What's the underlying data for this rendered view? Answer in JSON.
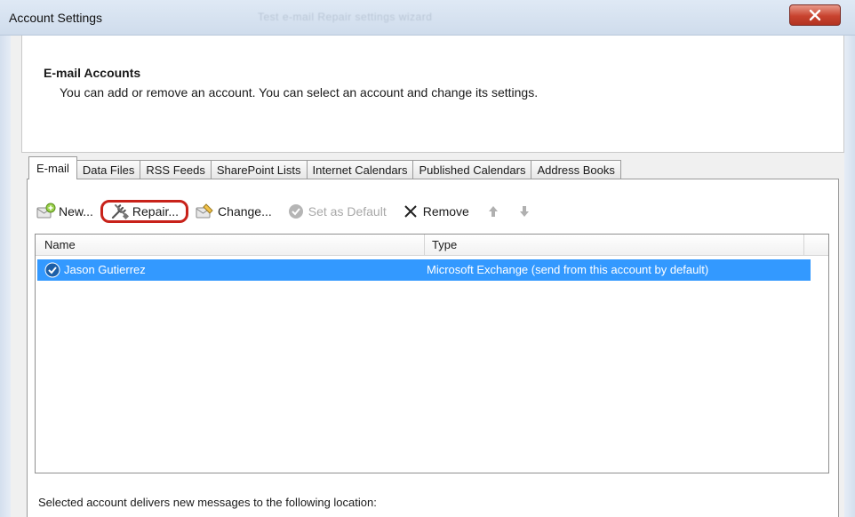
{
  "window": {
    "title": "Account Settings",
    "title_ghost": "Test e-mail   Repair settings wizard",
    "close_label": "close"
  },
  "header": {
    "title": "E-mail Accounts",
    "description": "You can add or remove an account. You can select an account and change its settings."
  },
  "tabs": [
    {
      "label": "E-mail",
      "active": true
    },
    {
      "label": "Data Files"
    },
    {
      "label": "RSS Feeds"
    },
    {
      "label": "SharePoint Lists"
    },
    {
      "label": "Internet Calendars"
    },
    {
      "label": "Published Calendars"
    },
    {
      "label": "Address Books"
    }
  ],
  "toolbar": {
    "new_label": "New...",
    "repair_label": "Repair...",
    "change_label": "Change...",
    "set_default_label": "Set as Default",
    "remove_label": "Remove"
  },
  "list": {
    "columns": [
      "Name",
      "Type"
    ],
    "rows": [
      {
        "name": "Jason Gutierrez",
        "type": "Microsoft Exchange (send from this account by default)",
        "selected": true
      }
    ]
  },
  "footer": {
    "text": "Selected account delivers new messages to the following location:"
  },
  "colors": {
    "selection": "#3399ff",
    "highlight_ring": "#c8221a",
    "close_button": "#c8432f"
  }
}
